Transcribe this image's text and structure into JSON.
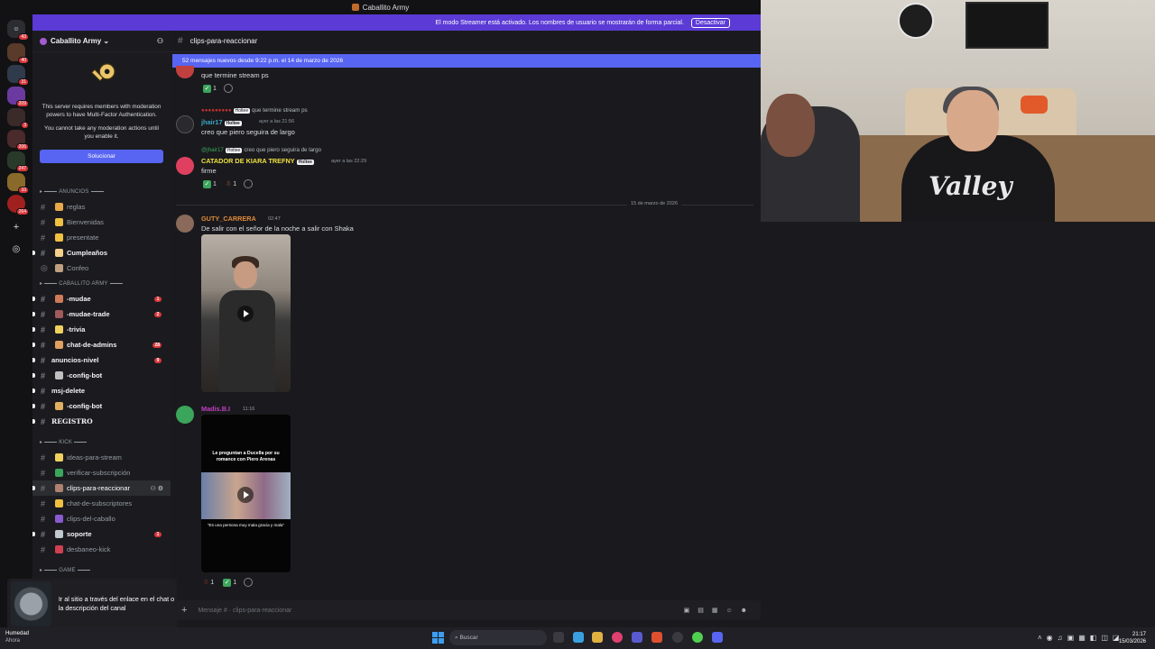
{
  "window": {
    "title": "Caballito Army"
  },
  "streamer_banner": {
    "text": "El modo Streamer está activado. Los nombres de usuario se mostrarán de forma parcial.",
    "button": "Desactivar"
  },
  "guild_rail": {
    "badges": [
      "43",
      "40",
      "31",
      "209",
      "3",
      "206",
      "247",
      "10",
      "264"
    ]
  },
  "sidebar": {
    "server_name": "Caballito Army",
    "mfa_notice": {
      "line1": "This server requires members with moderation powers to have Multi-Factor Authentication.",
      "line2": "You cannot take any moderation actions until you enable it.",
      "button": "Solucionar"
    },
    "categories": {
      "anuncios": "ANUNCIOS",
      "caballito": "CABALLITO ARMY",
      "kick": "KICK",
      "game": "GAME"
    },
    "channels_anuncios": [
      "reglas",
      "Bienvenidas",
      "presentate",
      "Cumpleaños",
      "Confeo"
    ],
    "channels_caballito": [
      "-mudae",
      "-mudae-trade",
      "-trivia",
      "chat-de-admins",
      "anuncios-nivel",
      "-config-bot",
      "msj-delete",
      "-config-bot",
      "REGISTRO"
    ],
    "mentions_caballito": [
      "1",
      "2",
      "",
      "28",
      "9",
      "",
      "",
      "",
      ""
    ],
    "channels_kick": [
      "ideas-para-stream",
      "verificar-subscripción",
      "clips-para-reaccionar",
      "chat-de-subscriptores",
      "clips-del-caballo",
      "soporte",
      "desbaneo-kick"
    ],
    "mentions_kick": [
      "",
      "",
      "",
      "",
      "",
      "1",
      ""
    ]
  },
  "notification": {
    "text": "Ir al sitio a través del enlace en el chat o la descripción del canal"
  },
  "chat": {
    "channel_name": "clips-para-reaccionar",
    "new_messages_bar": "52 mensajes nuevos desde 9:22 p.m. el 14 de marzo de 2026",
    "messages": [
      {
        "body": "que termine stream ps",
        "reactions": [
          "1"
        ]
      },
      {
        "reply_to": "que termine stream ps",
        "reply_tag": "Holtee",
        "user": "jhair17",
        "tag": "Holtee",
        "time": "ayer a las 21:56",
        "body": "creo que piero seguira de largo"
      },
      {
        "reply_user": "@jhair17",
        "reply_tag": "Holtee",
        "reply_to": "creo que piero seguira de largo",
        "user": "CATADOR DE KIARA TREFNY",
        "tag": "Holtee",
        "time": "ayer a las 22:29",
        "body": "firme",
        "reactions": [
          "1",
          "1"
        ]
      },
      {
        "user": "GUTY_CARRERA",
        "time": "02:47",
        "body": "De salir con el señor de la noche a salir con Shaka"
      },
      {
        "user": "Madis.B.I",
        "time": "11:16",
        "video_caption": "Le preguntan a Ducella por su romance con Piero Arenas",
        "video_caption2": "\"Es una persona muy mala gracia y mala\"",
        "reactions": [
          "1",
          "1"
        ]
      }
    ],
    "date_divider": "15 de marzo de 2026",
    "composer_placeholder": "Mensaje #  · clips-para-reaccionar"
  },
  "webcam": {
    "shirt_text": "Valley"
  },
  "taskbar": {
    "weather_title": "Humedad",
    "weather_sub": "Ahora",
    "search_placeholder": "Buscar",
    "time": "21:17",
    "date": "15/03/2026"
  }
}
